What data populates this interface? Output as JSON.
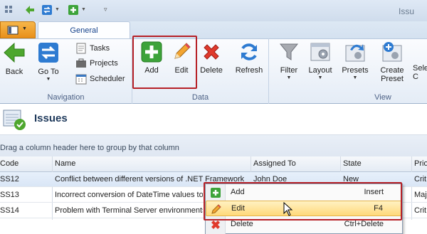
{
  "window": {
    "title_partial": "Issu"
  },
  "ribbon": {
    "tab": "General",
    "navigation": {
      "label": "Navigation",
      "back": "Back",
      "goto": "Go To",
      "tasks": "Tasks",
      "projects": "Projects",
      "scheduler": "Scheduler"
    },
    "data": {
      "label": "Data",
      "add": "Add",
      "edit": "Edit",
      "delete": "Delete",
      "refresh": "Refresh"
    },
    "view": {
      "label": "View",
      "filter": "Filter",
      "layout": "Layout",
      "presets": "Presets",
      "create_preset_1": "Create",
      "create_preset_2": "Preset",
      "select_partial_1": "Sele",
      "select_partial_2": "C"
    }
  },
  "page": {
    "title": "Issues"
  },
  "grid": {
    "group_hint": "Drag a column header here to group by that column",
    "columns": [
      "Code",
      "Name",
      "Assigned To",
      "State",
      "Prio"
    ],
    "rows": [
      {
        "code": "SS12",
        "name": "Conflict between different versions of .NET Framework",
        "assigned": "John Doe",
        "state": "New",
        "prio": "Crit"
      },
      {
        "code": "SS13",
        "name": "Incorrect conversion of DateTime values to",
        "assigned": "",
        "state": "",
        "prio": "Maj"
      },
      {
        "code": "SS14",
        "name": "Problem with Terminal Server environments",
        "assigned": "",
        "state": "",
        "prio": "Crit"
      }
    ]
  },
  "context_menu": {
    "items": [
      {
        "label": "Add",
        "shortcut": "Insert"
      },
      {
        "label": "Edit",
        "shortcut": "F4"
      },
      {
        "label": "Delete",
        "shortcut": "Ctrl+Delete"
      }
    ]
  },
  "colors": {
    "accent_red": "#b62026",
    "ribbon_text": "#15428b",
    "hover": "#ffd97a"
  }
}
